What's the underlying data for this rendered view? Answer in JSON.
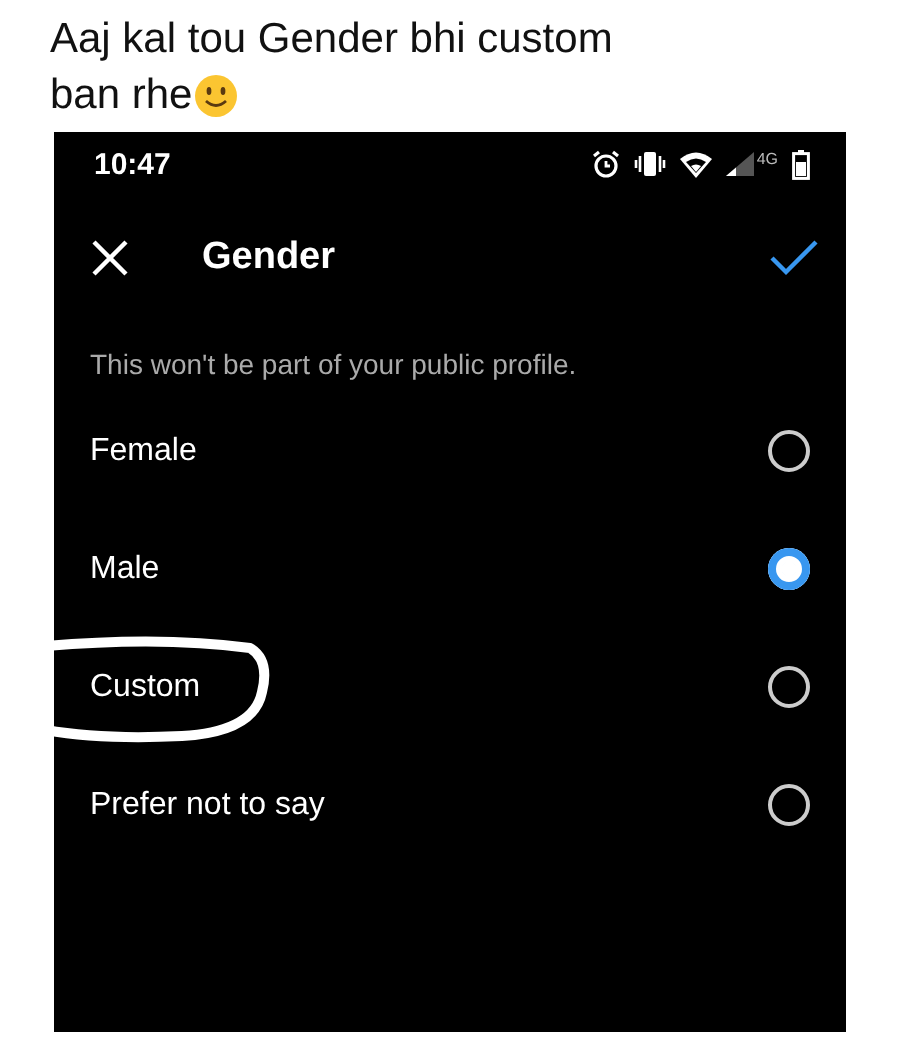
{
  "caption_lines": [
    "Aaj kal tou Gender bhi custom",
    "ban rhe"
  ],
  "status_bar": {
    "time": "10:47",
    "network": "4G"
  },
  "header": {
    "title": "Gender"
  },
  "hint": "This won't be part of your public profile.",
  "options": [
    {
      "label": "Female",
      "selected": false
    },
    {
      "label": "Male",
      "selected": true
    },
    {
      "label": "Custom",
      "selected": false,
      "circled": true
    },
    {
      "label": "Prefer not to say",
      "selected": false
    }
  ]
}
